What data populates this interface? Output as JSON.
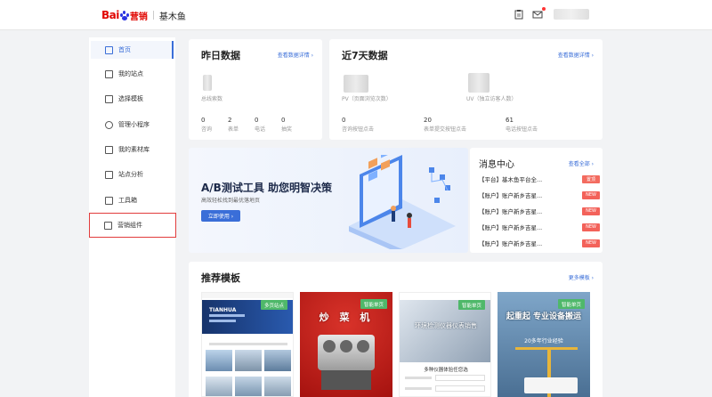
{
  "header": {
    "brand_bai": "Bai",
    "brand_ying": "营销",
    "product": "基木鱼"
  },
  "sidebar": {
    "items": [
      {
        "label": "首页",
        "icon": "home-icon"
      },
      {
        "label": "我的站点",
        "icon": "site-icon"
      },
      {
        "label": "选择模板",
        "icon": "template-icon"
      },
      {
        "label": "管理小程序",
        "icon": "miniprogram-icon"
      },
      {
        "label": "我的素材库",
        "icon": "image-icon"
      },
      {
        "label": "站点分析",
        "icon": "chart-icon"
      },
      {
        "label": "工具箱",
        "icon": "toolbox-icon"
      },
      {
        "label": "营销组件",
        "icon": "component-icon"
      }
    ]
  },
  "yesterday": {
    "title": "昨日数据",
    "link": "查看数据详情 ›",
    "total_label": "总线索数",
    "stats": [
      {
        "value": "0",
        "label": "咨询"
      },
      {
        "value": "2",
        "label": "表单"
      },
      {
        "value": "0",
        "label": "电话"
      },
      {
        "value": "0",
        "label": "抽奖"
      }
    ]
  },
  "week": {
    "title": "近7天数据",
    "link": "查看数据详情 ›",
    "pv_label": "PV（页面浏览次数）",
    "uv_label": "UV（独立访客人数）",
    "stats": [
      {
        "value": "0",
        "label": "咨询按钮点击"
      },
      {
        "value": "20",
        "label": "表单提交按钮点击"
      },
      {
        "value": "61",
        "label": "电话按钮点击"
      }
    ]
  },
  "banner": {
    "title": "A/B测试工具 助您明智决策",
    "subtitle": "高效轻松找到最优落地页",
    "button": "立即使用 ›"
  },
  "messages": {
    "title": "消息中心",
    "link": "查看全部 ›",
    "items": [
      {
        "text": "【平台】基木鱼平台全...",
        "badge": "置顶"
      },
      {
        "text": "【账户】账户新乡吉星...",
        "badge": "NEW"
      },
      {
        "text": "【账户】账户新乡吉星...",
        "badge": "NEW"
      },
      {
        "text": "【账户】账户新乡吉星...",
        "badge": "NEW"
      },
      {
        "text": "【账户】账户新乡吉星...",
        "badge": "NEW"
      }
    ]
  },
  "templates": {
    "title": "推荐模板",
    "link": "更多模板 ›",
    "items": [
      {
        "tag": "多页站点",
        "headline": "TIANHUA"
      },
      {
        "tag": "智能单页",
        "headline": "炒 菜 机"
      },
      {
        "tag": "智能单页",
        "headline": "环境检测仪器仪表销售",
        "footer": "多种仪器体验任您选"
      },
      {
        "tag": "智能单页",
        "headline": "起重起 专业设备搬运",
        "sub": "20多年行业经验"
      }
    ]
  },
  "colors": {
    "accent": "#3a6ed8",
    "brand_red": "#e10601",
    "badge_red": "#f3625a",
    "tag_green": "#4fb86a"
  }
}
